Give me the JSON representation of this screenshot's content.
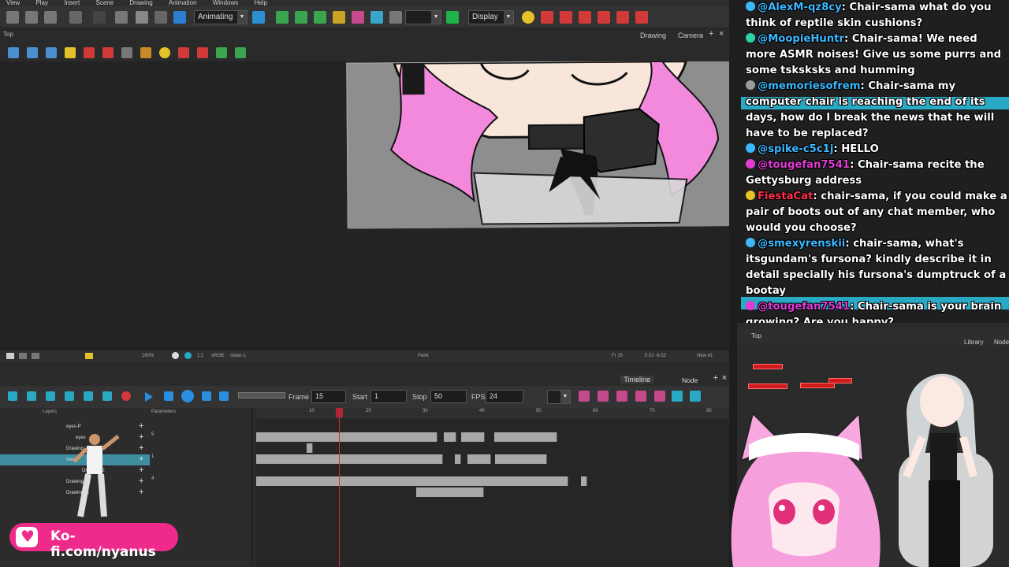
{
  "menu": [
    "View",
    "Play",
    "Insert",
    "Scene",
    "Drawing",
    "Animation",
    "Windows",
    "Help"
  ],
  "toolbar": {
    "mode_select": "Animating",
    "display_select": "Display",
    "accent_green": "#1fb24a",
    "accent_yellow": "#e6c229",
    "accent_red": "#d23a3a"
  },
  "view": {
    "title": "Top",
    "tabs": [
      "Drawing",
      "Camera"
    ]
  },
  "status_bar": {
    "zoom": "160%",
    "channel": "1:1",
    "color_space": "sRGB",
    "layer": "clean-1",
    "tool": "Paint",
    "frame": "Fr 15",
    "coords": "5.02 -6.52",
    "drawing": "New 41"
  },
  "timeline": {
    "tabs": [
      "Timeline",
      "Node Library"
    ],
    "frame_label": "Frame",
    "frame_value": "15",
    "start_label": "Start",
    "start_value": "1",
    "stop_label": "Stop",
    "stop_value": "50",
    "fps_label": "FPS",
    "fps_value": "24",
    "layers_label": "Layers",
    "params_label": "Parameters",
    "ruler": [
      "10",
      "20",
      "30",
      "40",
      "50",
      "60",
      "70",
      "80"
    ],
    "layers": [
      {
        "name": "eyes-P",
        "param": ""
      },
      {
        "name": "eyes",
        "param": "5"
      },
      {
        "name": "Drawing",
        "param": ""
      },
      {
        "name": "clean",
        "param": "1"
      },
      {
        "name": "Drawing_2",
        "param": ""
      },
      {
        "name": "Drawing_2",
        "param": "4"
      },
      {
        "name": "Drawing_3",
        "param": ""
      }
    ]
  },
  "kofi": {
    "label": "Ko-fi.com/nyanus",
    "color": "#ee2a8a"
  },
  "chat": {
    "messages": [
      {
        "user": "@AlexM-qz8cy",
        "user_color": "#3bb8ff",
        "text": "Chair-sama what do you think of reptile skin cushions?"
      },
      {
        "user": "@MoopieHuntr",
        "user_color": "#3bb8ff",
        "text": "Chair-sama! We need more ASMR noises! Give us some purrs and some tsksksks and humming"
      },
      {
        "user": "@memoriesofrem",
        "user_color": "#3bb8ff",
        "text": "Chair-sama my computer chair is reaching the end of its days, how do I break the news that he will have to be replaced?"
      },
      {
        "user": "@spike-c5c1j",
        "user_color": "#3bb8ff",
        "text": "HELLO"
      },
      {
        "user": "@tougefan7541",
        "user_color": "#e03cd4",
        "text": "Chair-sama recite the Gettysburg address"
      },
      {
        "user": "FiestaCat",
        "user_color": "#ff2f4a",
        "text": "chair-sama, if you could make a pair of boots out of any chat member, who would you choose?"
      },
      {
        "user": "@smexyrenskii",
        "user_color": "#3bb8ff",
        "text": "chair-sama, what's itsgundam's fursona? kindly describe it in detail specially his fursona's dumptruck of a bootay"
      },
      {
        "user": "@tougefan7541",
        "user_color": "#e03cd4",
        "text": "Chair-sama is your brain growing? Are you happy?"
      }
    ]
  },
  "node_panel": {
    "title": "Top",
    "tabs": [
      "Library",
      "Node"
    ]
  }
}
